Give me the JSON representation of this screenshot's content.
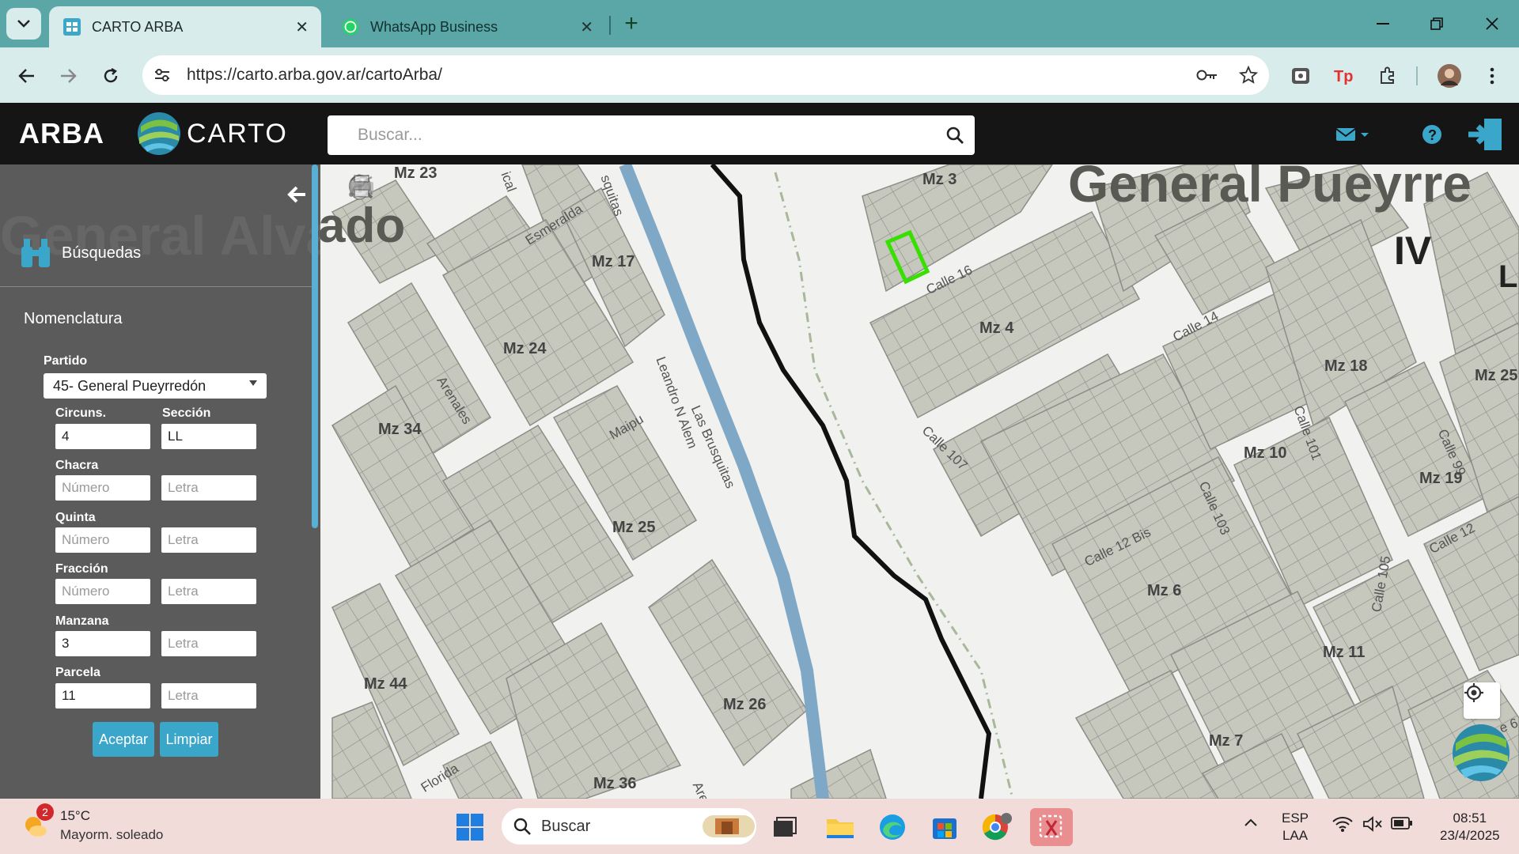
{
  "browser": {
    "tabs": [
      {
        "title": "CARTO ARBA",
        "favicon": "arba-favicon",
        "active": true
      },
      {
        "title": "WhatsApp Business",
        "favicon": "whatsapp-icon",
        "active": false
      }
    ],
    "url": "https://carto.arba.gov.ar/cartoArba/",
    "window_controls": [
      "minimize",
      "restore",
      "close"
    ]
  },
  "app": {
    "logo_arba": "ARBA",
    "logo_carto": "CARTO",
    "search_placeholder": "Buscar..."
  },
  "panel": {
    "background_text": "General Alvarado",
    "searches_label": "Búsquedas",
    "section_title": "Nomenclatura",
    "partido_label": "Partido",
    "partido_value": "45- General Pueyrredón",
    "fields": {
      "circuns_label": "Circuns.",
      "circuns_value": "4",
      "seccion_label": "Sección",
      "seccion_value": "LL",
      "chacra_label": "Chacra",
      "quinta_label": "Quinta",
      "fraccion_label": "Fracción",
      "manzana_label": "Manzana",
      "manzana_value": "3",
      "parcela_label": "Parcela",
      "parcela_value": "11",
      "numero_placeholder": "Número",
      "letra_placeholder": "Letra"
    },
    "accept_label": "Aceptar",
    "clear_label": "Limpiar"
  },
  "map": {
    "region_labels": [
      "General Pueyrre",
      "ado",
      "IV",
      "L"
    ],
    "blocks": [
      "Mz 23",
      "Mz 3",
      "Mz 17",
      "Mz 24",
      "Mz 4",
      "Mz 18",
      "Mz 25",
      "Mz 34",
      "Mz 10",
      "Mz 19",
      "Mz 25",
      "Mz 6",
      "Mz 44",
      "Mz 26",
      "Mz 11",
      "Mz 7",
      "Mz 36"
    ],
    "streets": [
      "Esmeralda",
      "squitas",
      "Calle 16",
      "Calle 14",
      "Arenales",
      "Leandro N Alem",
      "Las Brusquitas",
      "Maipu",
      "Calle 107",
      "Calle 101",
      "Calle 99",
      "Calle 12 Bis",
      "Calle 103",
      "Calle 105",
      "Calle 12",
      "Florida",
      "Are",
      "ical",
      "e 6"
    ],
    "highlight_color": "#37e000",
    "river_color": "#7ea8c6",
    "boundary_color": "#111111"
  },
  "taskbar": {
    "weather_badge": "2",
    "temperature": "15°C",
    "weather_desc": "Mayorm. soleado",
    "search_label": "Buscar",
    "lang_top": "ESP",
    "lang_bottom": "LAA",
    "time": "08:51",
    "date": "23/4/2025"
  }
}
